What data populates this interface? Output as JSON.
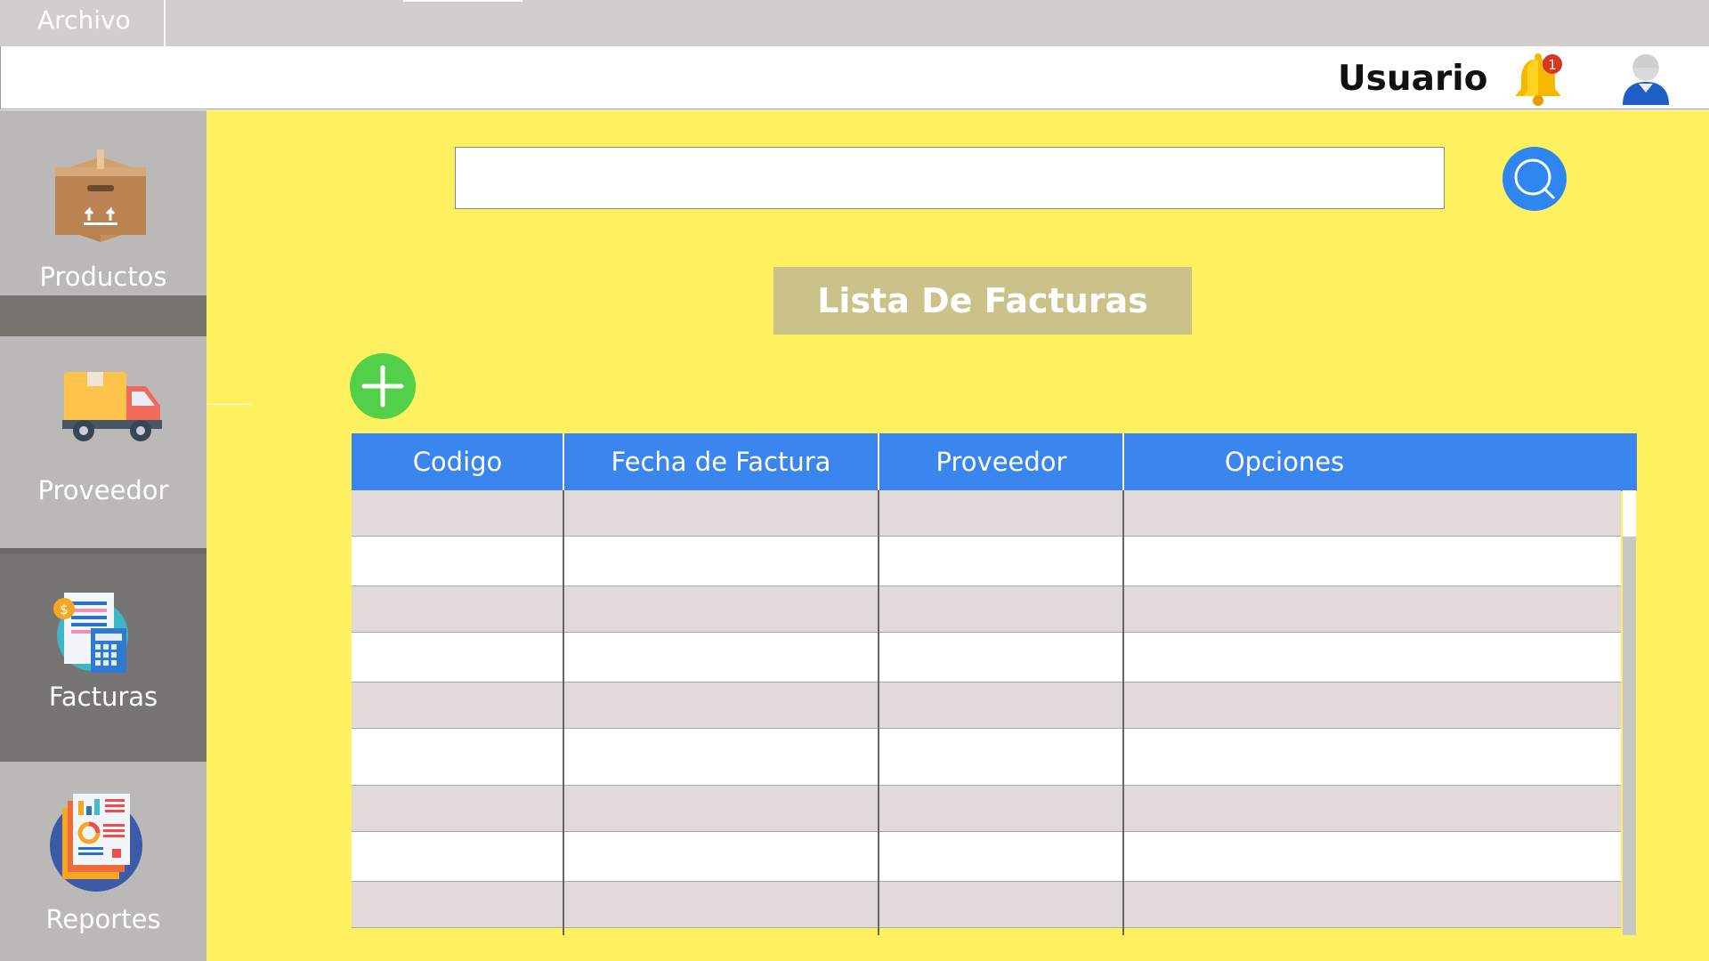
{
  "menubar": {
    "file_label": "Archivo"
  },
  "header": {
    "user_label": "Usuario",
    "notification_count": "1"
  },
  "sidebar": {
    "items": [
      {
        "label": "Productos",
        "icon": "box-icon",
        "active": false
      },
      {
        "label": "Proveedor",
        "icon": "truck-icon",
        "active": false
      },
      {
        "label": "Facturas",
        "icon": "invoice-icon",
        "active": true
      },
      {
        "label": "Reportes",
        "icon": "reports-icon",
        "active": false
      }
    ]
  },
  "search": {
    "placeholder": "",
    "value": ""
  },
  "main": {
    "title": "Lista De Facturas"
  },
  "table": {
    "columns": [
      "Codigo",
      "Fecha de Factura",
      "Proveedor",
      "Opciones"
    ],
    "rows": [
      [
        "",
        "",
        "",
        ""
      ],
      [
        "",
        "",
        "",
        ""
      ],
      [
        "",
        "",
        "",
        ""
      ],
      [
        "",
        "",
        "",
        ""
      ],
      [
        "",
        "",
        "",
        ""
      ],
      [
        "",
        "",
        "",
        ""
      ],
      [
        "",
        "",
        "",
        ""
      ],
      [
        "",
        "",
        "",
        ""
      ],
      [
        "",
        "",
        "",
        ""
      ]
    ]
  },
  "colors": {
    "main_bg": "#fff05f",
    "header_blue": "#3a86ee",
    "add_green": "#53d049",
    "search_blue": "#2f86f0",
    "title_bg": "#cbc28a"
  }
}
